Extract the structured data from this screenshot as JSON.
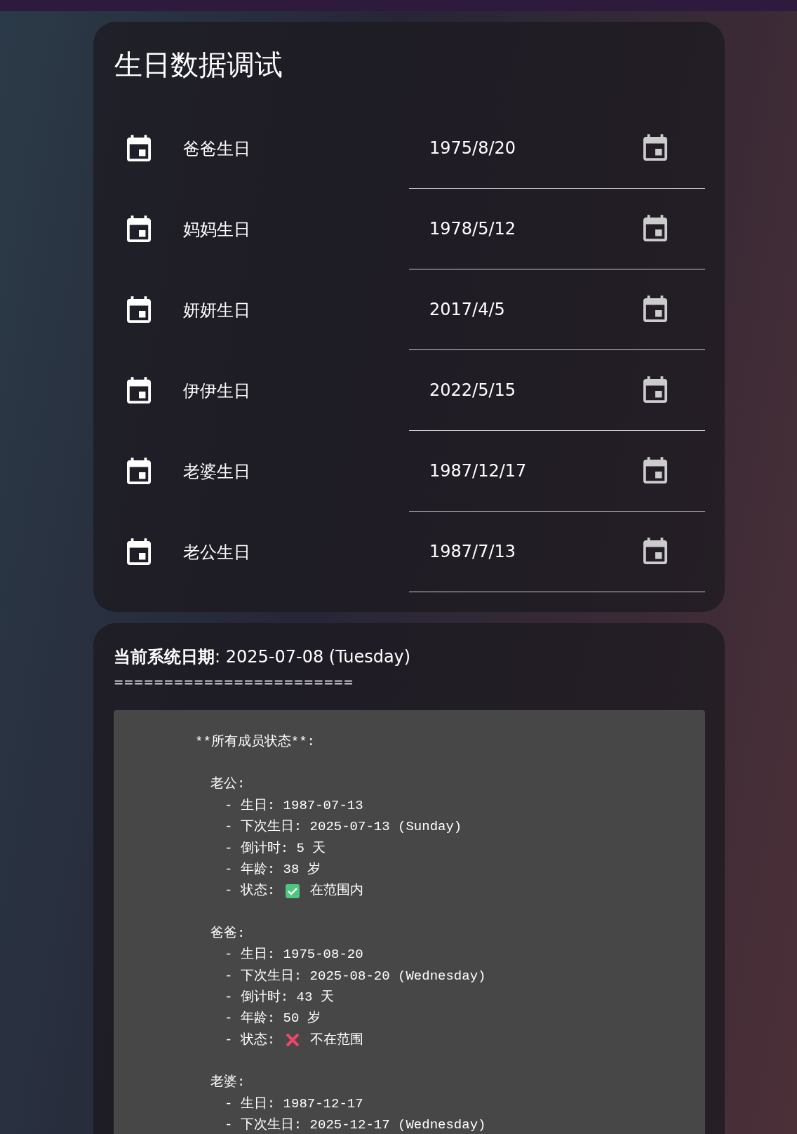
{
  "settings_card": {
    "title": "生日数据调试",
    "rows": [
      {
        "label": "爸爸生日",
        "value": "1975/8/20"
      },
      {
        "label": "妈妈生日",
        "value": "1978/5/12"
      },
      {
        "label": "妍妍生日",
        "value": "2017/4/5"
      },
      {
        "label": "伊伊生日",
        "value": "2022/5/15"
      },
      {
        "label": "老婆生日",
        "value": "1987/12/17"
      },
      {
        "label": "老公生日",
        "value": "1987/7/13"
      }
    ]
  },
  "debug_card": {
    "date_label": "当前系统日期",
    "date_value": ": 2025-07-08 (Tuesday)",
    "separator": "========================",
    "code": {
      "heading": "**所有成员状态**:",
      "members": [
        {
          "name": "老公:",
          "lines": [
            {
              "kind": "text",
              "text": "- 生日: 1987-07-13"
            },
            {
              "kind": "text",
              "text": "- 下次生日: 2025-07-13 (Sunday)"
            },
            {
              "kind": "text",
              "text": "- 倒计时: 5 天"
            },
            {
              "kind": "text",
              "text": "- 年龄: 38 岁"
            },
            {
              "kind": "status",
              "text": "- 状态:",
              "ok": true,
              "status_text": "在范围内"
            }
          ]
        },
        {
          "name": "爸爸:",
          "lines": [
            {
              "kind": "text",
              "text": "- 生日: 1975-08-20"
            },
            {
              "kind": "text",
              "text": "- 下次生日: 2025-08-20 (Wednesday)"
            },
            {
              "kind": "text",
              "text": "- 倒计时: 43 天"
            },
            {
              "kind": "text",
              "text": "- 年龄: 50 岁"
            },
            {
              "kind": "status",
              "text": "- 状态:",
              "ok": false,
              "status_text": "不在范围"
            }
          ]
        },
        {
          "name": "老婆:",
          "lines": [
            {
              "kind": "text",
              "text": "- 生日: 1987-12-17"
            },
            {
              "kind": "text",
              "text": "- 下次生日: 2025-12-17 (Wednesday)"
            }
          ]
        }
      ]
    }
  }
}
